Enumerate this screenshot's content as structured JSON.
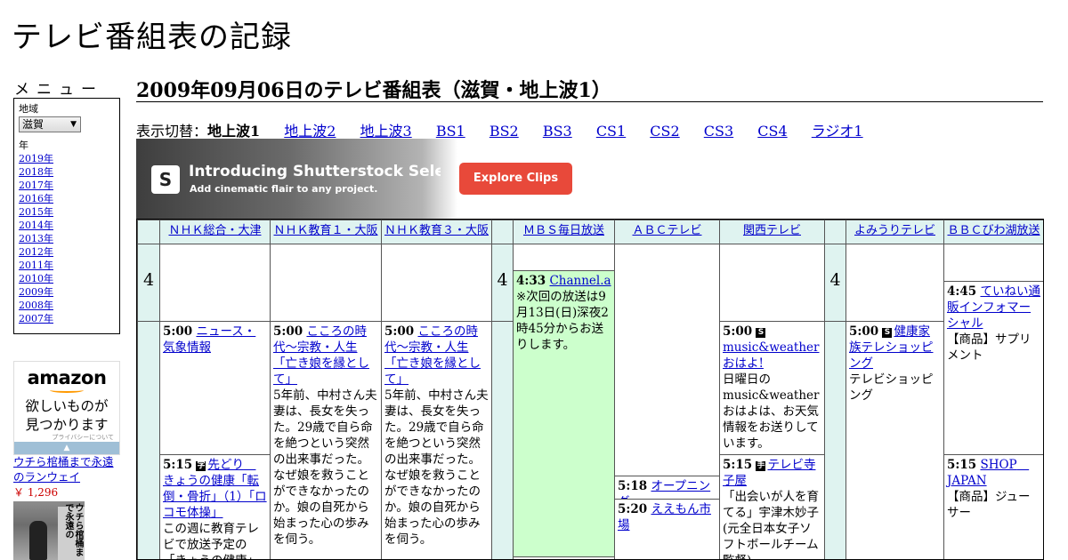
{
  "site": {
    "title": "テレビ番組表の記録"
  },
  "menu": {
    "heading": "メニュー",
    "region_label": "地域",
    "region_value": "滋賀",
    "year_label": "年",
    "years": [
      "2019年",
      "2018年",
      "2017年",
      "2016年",
      "2015年",
      "2014年",
      "2013年",
      "2012年",
      "2011年",
      "2010年",
      "2009年",
      "2008年",
      "2007年"
    ]
  },
  "ad_sidebar": {
    "logo": "amazon",
    "tagline_1": "欲しいものが",
    "tagline_2": "見つかります",
    "privacy": "プライバシーについて",
    "product_title": "ウチら棺桶まで永遠のランウェイ",
    "product_price": "￥ 1,296",
    "product_image_text": "ウチら棺桶まで永遠の"
  },
  "page": {
    "heading": "2009年09月06日のテレビ番組表（滋賀・地上波1）"
  },
  "switcher": {
    "label": "表示切替：",
    "current": "地上波1",
    "links": [
      "地上波2",
      "地上波3",
      "BS1",
      "BS2",
      "BS3",
      "CS1",
      "CS2",
      "CS3",
      "CS4",
      "ラジオ1"
    ]
  },
  "banner": {
    "logo": "S",
    "headline": "Introducing Shutterstock Select",
    "subline": "Add cinematic flair to any project.",
    "button": "Explore Clips"
  },
  "schedule": {
    "channels": [
      "ＮＨＫ総合・大津",
      "ＮＨＫ教育１・大阪",
      "ＮＨＫ教育３・大阪",
      "ＭＢＳ毎日放送",
      "ＡＢＣテレビ",
      "関西テレビ",
      "よみうりテレビ",
      "ＢＢＣびわ湖放送"
    ],
    "hour_4": "4",
    "programs": {
      "mbs_433": {
        "time": "4:33",
        "title": "Channel.a",
        "desc": "※次回の放送は9月13日(日)深夜2時45分からお送りします。"
      },
      "bbc_445": {
        "time": "4:45",
        "title": "ていねい通販インフォマーシャル",
        "desc": "【商品】サプリメント"
      },
      "nhkg_500": {
        "time": "5:00",
        "title": "ニュース・気象情報"
      },
      "nhke1_500": {
        "time": "5:00",
        "title": "こころの時代～宗教・人生「亡き娘を縁として」",
        "desc": "5年前、中村さん夫妻は、長女を失った。29歳で自ら命を絶つという突然の出来事だった。なぜ娘を救うことができなかったのか。娘の自死から始まった心の歩みを伺う。"
      },
      "nhke3_500": {
        "time": "5:00",
        "title": "こころの時代～宗教・人生「亡き娘を縁として」",
        "desc": "5年前、中村さん夫妻は、長女を失った。29歳で自ら命を絶つという突然の出来事だった。なぜ娘を救うことができなかったのか。娘の自死から始まった心の歩みを伺う。"
      },
      "ktv_500": {
        "time": "5:00",
        "symbol": "S",
        "title": "music&weatherおはよ!",
        "desc": "日曜日のmusic&weatherおはよは、お天気情報をお送りしています。"
      },
      "ytv_500": {
        "time": "5:00",
        "symbol": "S",
        "title": "健康家族テレショッピング",
        "desc": "テレビショッピング"
      },
      "nhkg_515": {
        "time": "5:15",
        "symbol": "字",
        "title": "先どり　きょうの健康「転倒・骨折」（1）「ロコモ体操」",
        "desc": "この週に教育テレビで放送予定の「きょうの健康」"
      },
      "ktv_515": {
        "time": "5:15",
        "symbol": "手",
        "title": "テレビ寺子屋",
        "desc": "「出会いが人を育てる」宇津木妙子(元全日本女子ソフトボールチーム監督)"
      },
      "bbc_515": {
        "time": "5:15",
        "title": "SHOP　JAPAN",
        "desc": "【商品】ジューサー"
      },
      "abc_518": {
        "time": "5:18",
        "title": "オープニング"
      },
      "abc_520": {
        "time": "5:20",
        "title": "ええもん市場"
      }
    }
  }
}
